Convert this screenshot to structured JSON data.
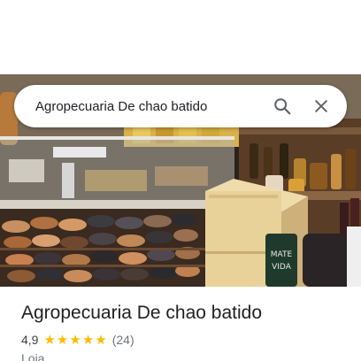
{
  "search": {
    "query": "Agropecuaria De chao batido",
    "search_icon": "search-icon",
    "close_icon": "close-icon"
  },
  "photo": {
    "sign_text": "MATE\nVIDA"
  },
  "place": {
    "name": "Agropecuaria De chao batido",
    "rating": "4,9",
    "stars": 5,
    "review_count": "(24)",
    "category": "Loja"
  },
  "colors": {
    "star": "#fbbc04",
    "title": "#202124",
    "secondary": "#70757a"
  }
}
